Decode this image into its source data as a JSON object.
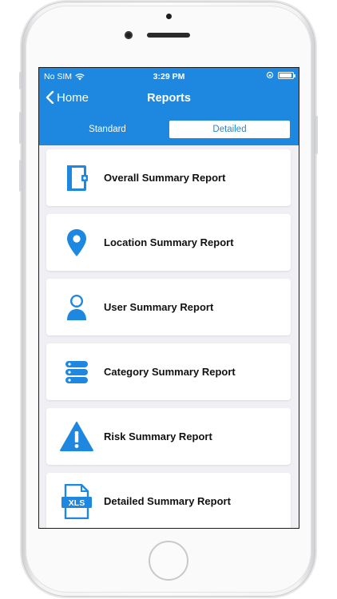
{
  "status_bar": {
    "carrier": "No SIM",
    "time": "3:29 PM"
  },
  "nav": {
    "back_label": "Home",
    "title": "Reports"
  },
  "segments": {
    "standard": "Standard",
    "detailed": "Detailed",
    "selected": "Detailed"
  },
  "reports": [
    {
      "label": "Overall Summary Report",
      "icon": "binder-icon"
    },
    {
      "label": "Location Summary Report",
      "icon": "location-pin-icon"
    },
    {
      "label": "User Summary Report",
      "icon": "user-icon"
    },
    {
      "label": "Category Summary Report",
      "icon": "stacked-list-icon"
    },
    {
      "label": "Risk Summary Report",
      "icon": "warning-icon"
    },
    {
      "label": "Detailed Summary Report",
      "icon": "xls-file-icon"
    }
  ],
  "xls_badge": "XLS",
  "colors": {
    "accent": "#1e88e0",
    "background": "#efeff4",
    "card": "#ffffff",
    "text": "#111111"
  }
}
